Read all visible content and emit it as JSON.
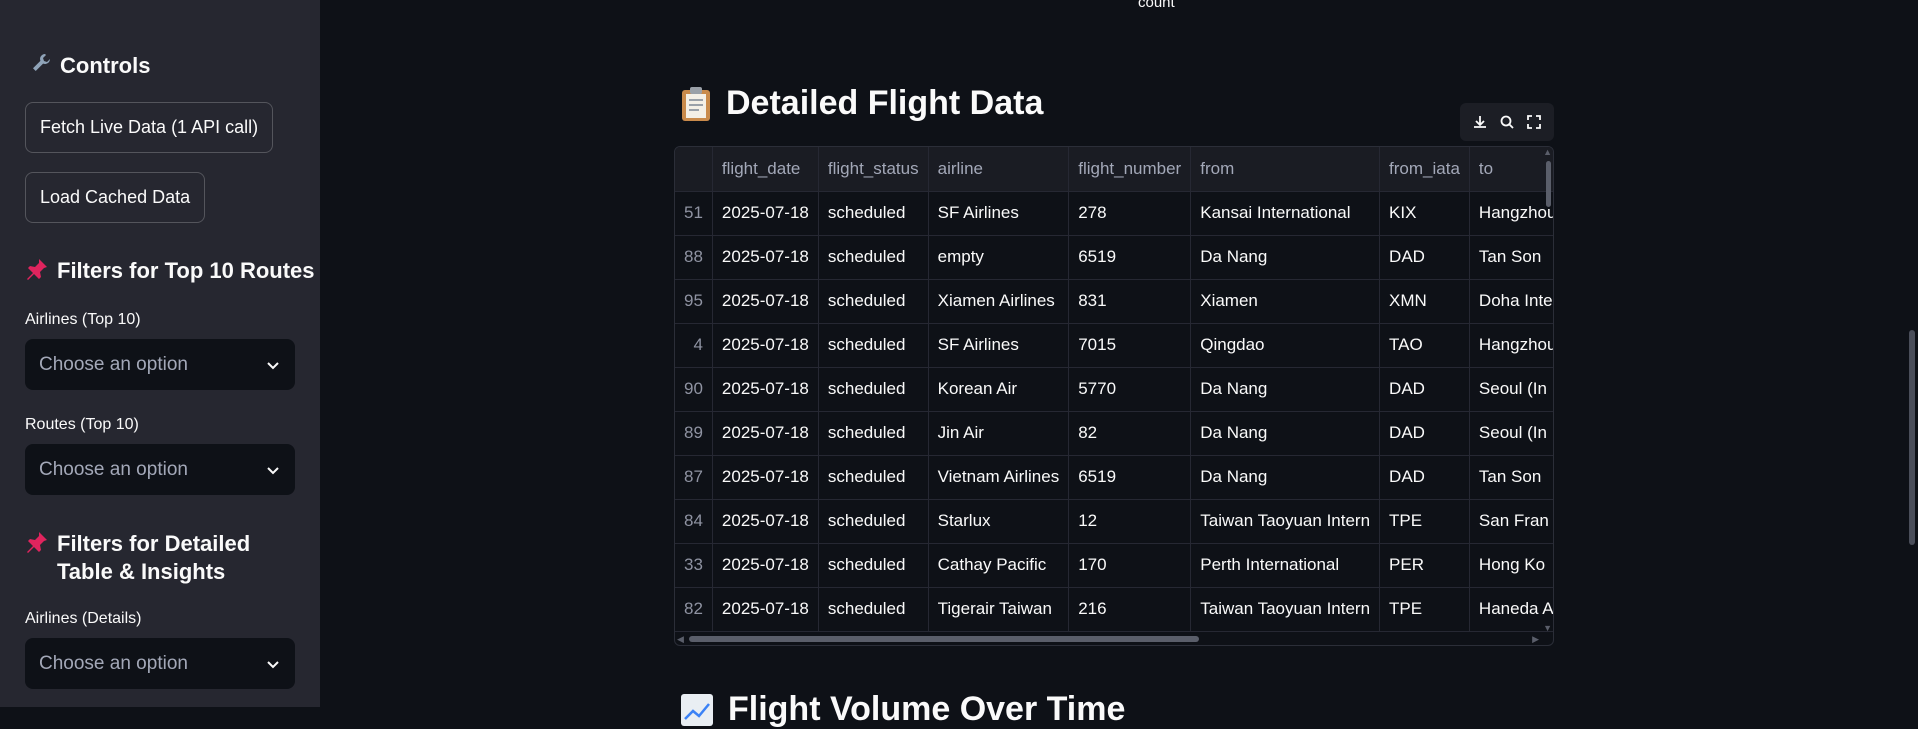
{
  "sidebar": {
    "controls_title": "Controls",
    "fetch_button": "Fetch Live Data (1 API call)",
    "cached_button": "Load Cached Data",
    "filters_top_title": "Filters for Top 10 Routes",
    "airlines_top_label": "Airlines (Top 10)",
    "airlines_top_placeholder": "Choose an option",
    "routes_top_label": "Routes (Top 10)",
    "routes_top_placeholder": "Choose an option",
    "filters_detail_title": "Filters for Detailed Table & Insights",
    "airlines_detail_label": "Airlines (Details)",
    "airlines_detail_placeholder": "Choose an option"
  },
  "main": {
    "top_axis_label": "count",
    "section_title": "Detailed Flight Data",
    "next_section_title": "Flight Volume Over Time",
    "table": {
      "columns": [
        "",
        "flight_date",
        "flight_status",
        "airline",
        "flight_number",
        "from",
        "from_iata",
        "to"
      ],
      "rows": [
        [
          "51",
          "2025-07-18",
          "scheduled",
          "SF Airlines",
          "278",
          "Kansai International",
          "KIX",
          "Hangzhou"
        ],
        [
          "88",
          "2025-07-18",
          "scheduled",
          "empty",
          "6519",
          "Da Nang",
          "DAD",
          "Tan Son"
        ],
        [
          "95",
          "2025-07-18",
          "scheduled",
          "Xiamen Airlines",
          "831",
          "Xiamen",
          "XMN",
          "Doha Inte"
        ],
        [
          "4",
          "2025-07-18",
          "scheduled",
          "SF Airlines",
          "7015",
          "Qingdao",
          "TAO",
          "Hangzhou"
        ],
        [
          "90",
          "2025-07-18",
          "scheduled",
          "Korean Air",
          "5770",
          "Da Nang",
          "DAD",
          "Seoul (In"
        ],
        [
          "89",
          "2025-07-18",
          "scheduled",
          "Jin Air",
          "82",
          "Da Nang",
          "DAD",
          "Seoul (In"
        ],
        [
          "87",
          "2025-07-18",
          "scheduled",
          "Vietnam Airlines",
          "6519",
          "Da Nang",
          "DAD",
          "Tan Son"
        ],
        [
          "84",
          "2025-07-18",
          "scheduled",
          "Starlux",
          "12",
          "Taiwan Taoyuan Intern",
          "TPE",
          "San Fran"
        ],
        [
          "33",
          "2025-07-18",
          "scheduled",
          "Cathay Pacific",
          "170",
          "Perth International",
          "PER",
          "Hong Ko"
        ],
        [
          "82",
          "2025-07-18",
          "scheduled",
          "Tigerair Taiwan",
          "216",
          "Taiwan Taoyuan Intern",
          "TPE",
          "Haneda A"
        ]
      ]
    }
  },
  "icons": {
    "controls": "wrench-icon",
    "pin": "pushpin-icon",
    "clipboard": "clipboard-icon",
    "download": "download-icon",
    "search": "search-icon",
    "fullscreen": "fullscreen-icon",
    "chart": "chart-icon",
    "chevron": "chevron-down-icon"
  },
  "colors": {
    "sidebar_bg": "#262730",
    "main_bg": "#0e1117",
    "pin_red": "#e0245e"
  }
}
